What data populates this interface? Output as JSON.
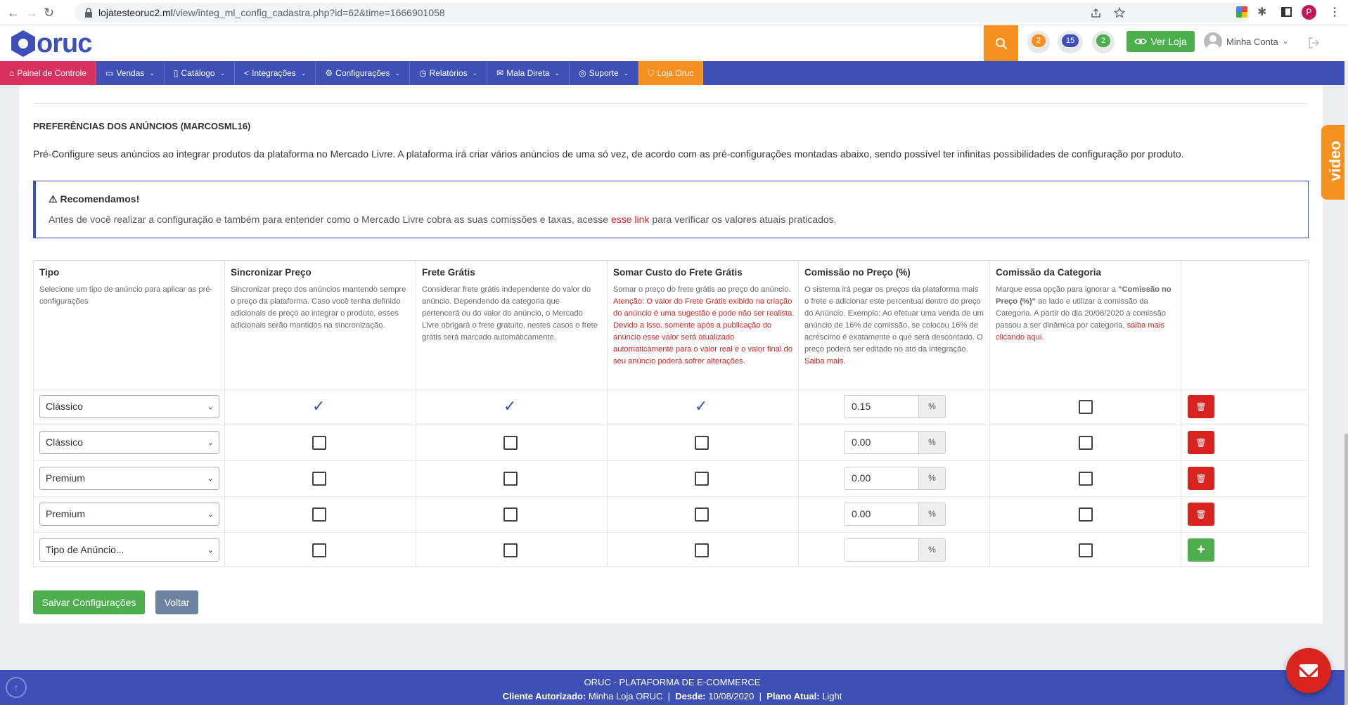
{
  "browser": {
    "url_host": "lojatesteoruc2.ml",
    "url_path": "/view/integ_ml_config_cadastra.php?id=62&time=1666901058",
    "back_icon": "←",
    "forward_icon": "→",
    "reload_icon": "↻",
    "profile_initial": "P"
  },
  "header": {
    "logo_text": "oruc",
    "notifications": [
      {
        "count": "2",
        "color": "#f6901e"
      },
      {
        "count": "15",
        "color": "#3e4fb7"
      },
      {
        "count": "2",
        "color": "#4cae4c"
      }
    ],
    "ver_loja_label": "Ver Loja",
    "account_label": "Minha Conta"
  },
  "nav": {
    "painel": "Painel de Controle",
    "vendas": "Vendas",
    "catalogo": "Catálogo",
    "integracoes": "Integrações",
    "configuracoes": "Configurações",
    "relatorios": "Relatórios",
    "mala_direta": "Mala Direta",
    "suporte": "Suporte",
    "loja_oruc": "Loja Oruc"
  },
  "page": {
    "title": "PREFERÊNCIAS DOS ANÚNCIOS (MARCOSML16)",
    "description": "Pré-Configure seus anúncios ao integrar produtos da plataforma no Mercado Livre. A plataforma irá criar vários anúncios de uma só vez, de acordo com as pré-configurações montadas abaixo, sendo possível ter infinitas possibilidades de configuração por produto."
  },
  "alert": {
    "title": "Recomendamos!",
    "text_before": "Antes de você realizar a configuração e também para entender como o Mercado Livre cobra as suas comissões e taxas, acesse ",
    "link": "esse link",
    "text_after": " para verificar os valores atuais praticados."
  },
  "table": {
    "columns": [
      {
        "title": "Tipo",
        "desc": "Selecione um tipo de anúncio para aplicar as pré-configurações"
      },
      {
        "title": "Sincronizar Preço",
        "desc": "Sincronizar preço dos anúncios mantendo sempre o preço da plataforma. Caso você tenha definido adicionais de preço ao integrar o produto, esses adicionais serão mantidos na sincronização."
      },
      {
        "title": "Frete Grátis",
        "desc": "Considerar frete grátis independente do valor do anúncio. Dependendo da categoria que pertencerá ou do valor do anúncio, o Mercado Livre obrigará o frete gratuito, nestes casos o frete grátis será marcado automáticamente."
      },
      {
        "title": "Somar Custo do Frete Grátis",
        "desc": "Somar o preço do frete grátis ao preço do anúncio.",
        "desc_red": "Atenção: O valor do Frete Grátis exibido na criação do anúncio é uma sugestão e pode não ser realista. Devido a isso, somente após a publicação do anúncio esse valor será atualizado automaticamente para o valor real e o valor final do seu anúncio poderá sofrer alterações."
      },
      {
        "title": "Comissão no Preço (%)",
        "desc": "O sistema irá pegar os preços da plataforma mais o frete e adicionar este percentual dentro do preço do Anúncio. Exemplo: Ao efetuar uma venda de um anúncio de 16% de comissão, se colocou 16% de acréscimo é exatamente o que será descontado. O preço poderá ser editado no ato da integração.",
        "desc_red": "Saiba mais."
      },
      {
        "title": "Comissão da Categoria",
        "desc_a": "Marque essa opção para ignorar a ",
        "desc_bold": "\"Comissão no Preço (%)\"",
        "desc_b": " ao lado e utilizar a comissão da Categoria. A partir do dia 20/08/2020 a comissão passou a ser dinâmica por categoria, ",
        "desc_red": "saiba mais clicando aqui."
      }
    ],
    "rows": [
      {
        "tipo": "Clássico",
        "sync": true,
        "frete": true,
        "somar": true,
        "comissao": "0.15",
        "categoria": false
      },
      {
        "tipo": "Clássico",
        "sync": false,
        "frete": false,
        "somar": false,
        "comissao": "0.00",
        "categoria": false
      },
      {
        "tipo": "Premium",
        "sync": false,
        "frete": false,
        "somar": false,
        "comissao": "0.00",
        "categoria": false
      },
      {
        "tipo": "Premium",
        "sync": false,
        "frete": false,
        "somar": false,
        "comissao": "0.00",
        "categoria": false
      },
      {
        "tipo": "Tipo de Anúncio...",
        "sync": false,
        "frete": false,
        "somar": false,
        "comissao": "",
        "categoria": false
      }
    ],
    "percent_symbol": "%",
    "checkmark": "✓",
    "select_arrow": "⌄",
    "delete_icon": "🗑",
    "add_icon": "+"
  },
  "buttons": {
    "save": "Salvar Configurações",
    "back": "Voltar"
  },
  "footer": {
    "line1": "ORUC - PLATAFORMA DE E-COMMERCE",
    "cliente_label": "Cliente Autorizado:",
    "cliente_value": "Minha Loja ORUC",
    "desde_label": "Desde:",
    "desde_value": "10/08/2020",
    "plano_label": "Plano Atual:",
    "plano_value": "Light",
    "separator": "|"
  },
  "video_tab": "video"
}
